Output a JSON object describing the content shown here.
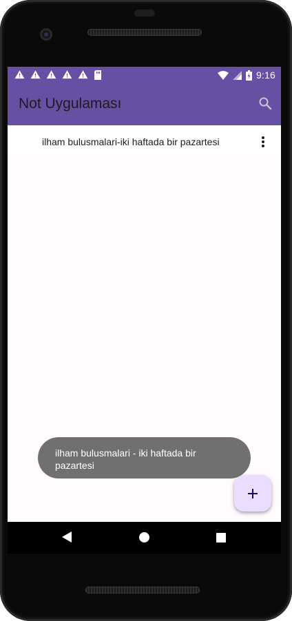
{
  "status_bar": {
    "time": "9:16",
    "left_icons": [
      "warning-icon",
      "warning-icon",
      "warning-icon",
      "warning-icon",
      "warning-icon",
      "sd-card-icon"
    ],
    "right_icons": [
      "wifi-icon",
      "signal-icon",
      "battery-icon"
    ]
  },
  "app_bar": {
    "title": "Not Uygulaması",
    "action_icon": "search-icon",
    "color": "#6750a4"
  },
  "notes": [
    {
      "text": "ilham bulusmalari-iki haftada bir pazartesi",
      "menu_icon": "more-vert-icon"
    }
  ],
  "toast": {
    "message": "ilham bulusmalari - iki haftada bir pazartesi"
  },
  "fab": {
    "icon": "plus-icon",
    "color": "#eaddff"
  },
  "nav_bar": {
    "buttons": [
      "back-icon",
      "home-icon",
      "recents-icon"
    ]
  }
}
